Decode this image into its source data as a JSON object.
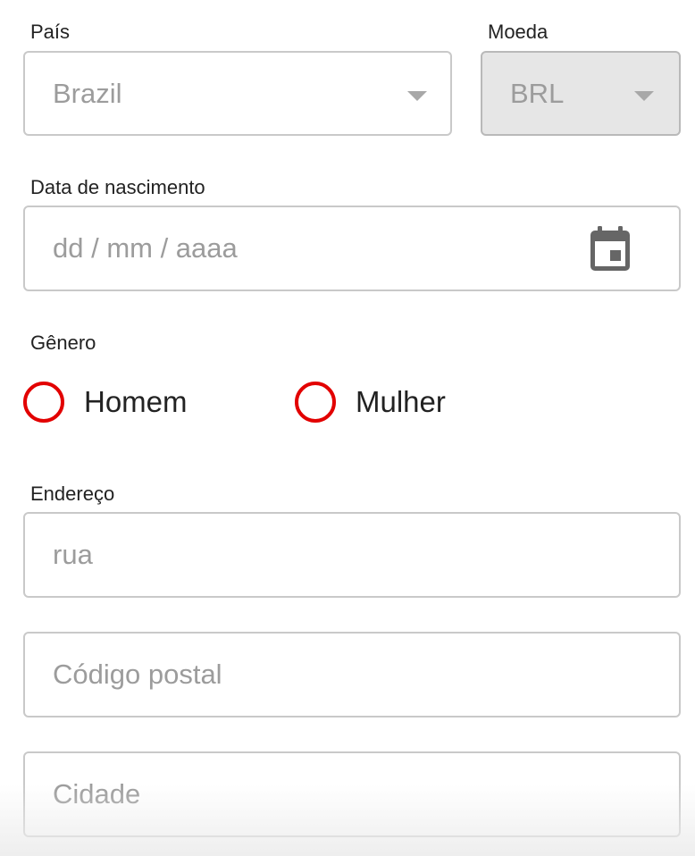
{
  "country": {
    "label": "País",
    "value": "Brazil"
  },
  "currency": {
    "label": "Moeda",
    "value": "BRL",
    "disabled": true
  },
  "birthdate": {
    "label": "Data de nascimento",
    "placeholder": "dd / mm / aaaa",
    "icon": "calendar-icon"
  },
  "gender": {
    "label": "Gênero",
    "options": [
      {
        "label": "Homem",
        "selected": false
      },
      {
        "label": "Mulher",
        "selected": false
      }
    ]
  },
  "address": {
    "label": "Endereço",
    "street_placeholder": "rua",
    "postal_placeholder": "Código postal",
    "city_placeholder": "Cidade"
  },
  "colors": {
    "radio_accent": "#e20000",
    "placeholder": "#9c9c9c",
    "border": "#c9c9c9",
    "disabled_bg": "#e6e6e6"
  }
}
